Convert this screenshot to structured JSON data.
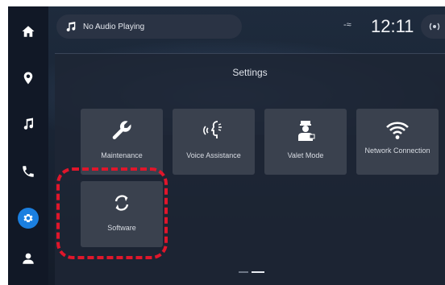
{
  "top_bar": {
    "audio_label": "No Audio Playing",
    "signal": "-≈",
    "clock": "12:11"
  },
  "settings": {
    "title": "Settings",
    "tiles": [
      {
        "label": "Maintenance",
        "icon": "wrench-icon"
      },
      {
        "label": "Voice Assistance",
        "icon": "voice-assistant-icon"
      },
      {
        "label": "Valet Mode",
        "icon": "valet-icon"
      },
      {
        "label": "Network Connection",
        "icon": "wifi-icon"
      },
      {
        "label": "Software",
        "icon": "refresh-icon"
      }
    ]
  },
  "rail": {
    "items": [
      "home-icon",
      "location-icon",
      "music-icon",
      "phone-icon",
      "settings-icon",
      "profile-icon"
    ],
    "active": "settings-icon"
  },
  "colors": {
    "accent": "#1b7fe0",
    "highlight": "#e0162b"
  }
}
